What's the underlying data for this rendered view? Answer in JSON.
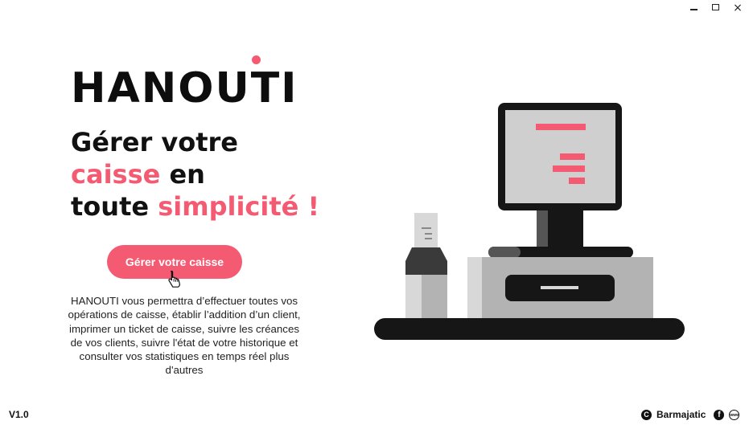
{
  "window": {
    "minimize_icon": "minimize-icon",
    "maximize_icon": "maximize-icon",
    "close_icon": "close-icon",
    "close_glyph": "×"
  },
  "brand": {
    "logo_text": "HANOUTI",
    "accent_color": "#f45b73"
  },
  "headline": {
    "line1": "Gérer votre",
    "line2_accent": "caisse",
    "line2_rest": " en",
    "line3_start": "toute ",
    "line3_accent": "simplicité !"
  },
  "cta": {
    "label": "Gérer votre caisse"
  },
  "description": "HANOUTI vous permettra d’effectuer toutes vos opérations de caisse, établir l’addition d’un client, imprimer un ticket de caisse, suivre les créances de vos clients, suivre l'état de votre historique et consulter vos statistiques en temps réel plus d'autres",
  "footer": {
    "version": "V1.0",
    "copyright_icon": "copyright-icon",
    "company": "Barmajatic",
    "facebook_icon": "facebook-icon",
    "website_icon": "website-icon",
    "website_glyph": "www"
  }
}
